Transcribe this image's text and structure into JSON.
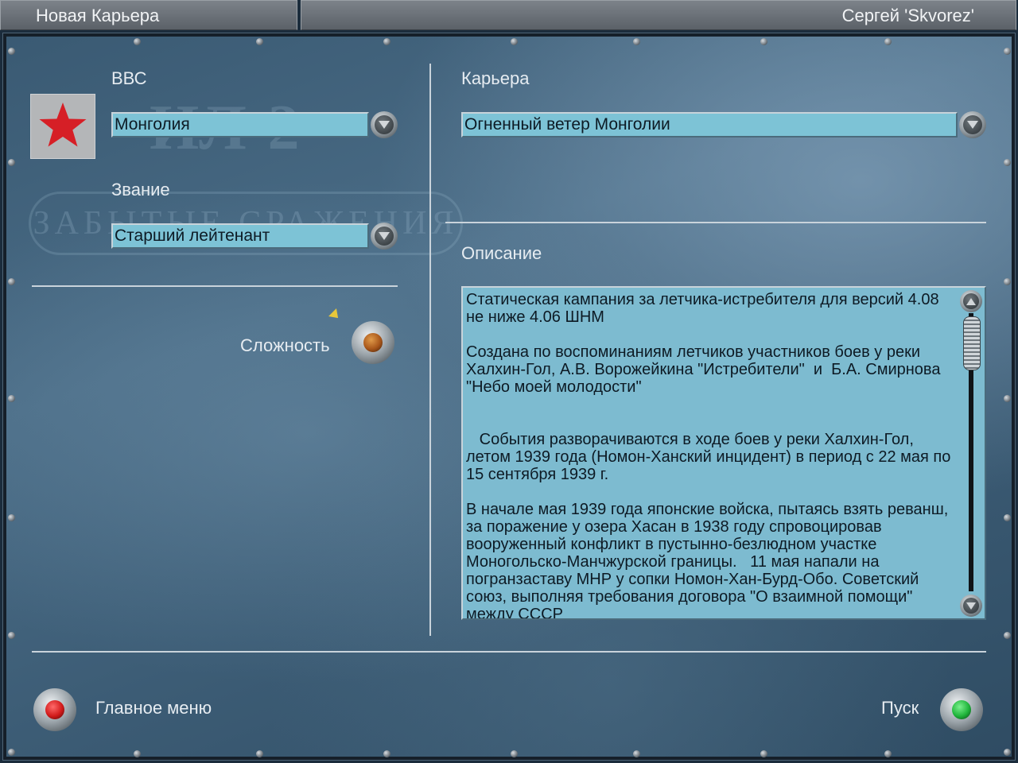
{
  "topbar": {
    "screen_title": "Новая Карьера",
    "player_name": "Сергей 'Skvorez'"
  },
  "watermark": {
    "top": "ИЛ-2",
    "subtitle": "ЗАБЫТЫЕ СРАЖЕНИЯ"
  },
  "left": {
    "air_force_label": "ВВС",
    "air_force_value": "Монголия",
    "rank_label": "Звание",
    "rank_value": "Старший лейтенант",
    "difficulty_label": "Сложность"
  },
  "right": {
    "career_label": "Карьера",
    "career_value": "Огненный ветер Монголии",
    "description_label": "Описание",
    "description_text": "Статическая кампания за летчика-истребителя для версий 4.08 не ниже 4.06 ШНМ\n\nСоздана по воспоминаниям летчиков участников боев у реки Халхин-Гол, А.В. Ворожейкина \"Истребители\"  и  Б.А. Смирнова \"Небо моей молодости\"\n\n\n   События разворачиваются в ходе боев у реки Халхин-Гол, летом 1939 года (Номон-Ханский инцидент) в период с 22 мая по 15 сентября 1939 г.\n\nВ начале мая 1939 года японские войска, пытаясь взять реванш, за поражение у озера Хасан в 1938 году спровоцировав вооруженный конфликт в пустынно-безлюдном участке Моногольско-Манчжурской границы.   11 мая напали на  погранзаставу МНР у сопки Номон-Хан-Бурд-Обо. Советский союз, выполняя требования договора \"О взаимной помощи\" между СССР"
  },
  "footer": {
    "main_menu_label": "Главное меню",
    "start_label": "Пуск"
  },
  "colors": {
    "field_bg": "#7dc3d6",
    "flag_star": "#d61f26",
    "lamp_red": "#d11a1a",
    "lamp_green": "#1fb43a",
    "lamp_amber": "#a8561a"
  }
}
